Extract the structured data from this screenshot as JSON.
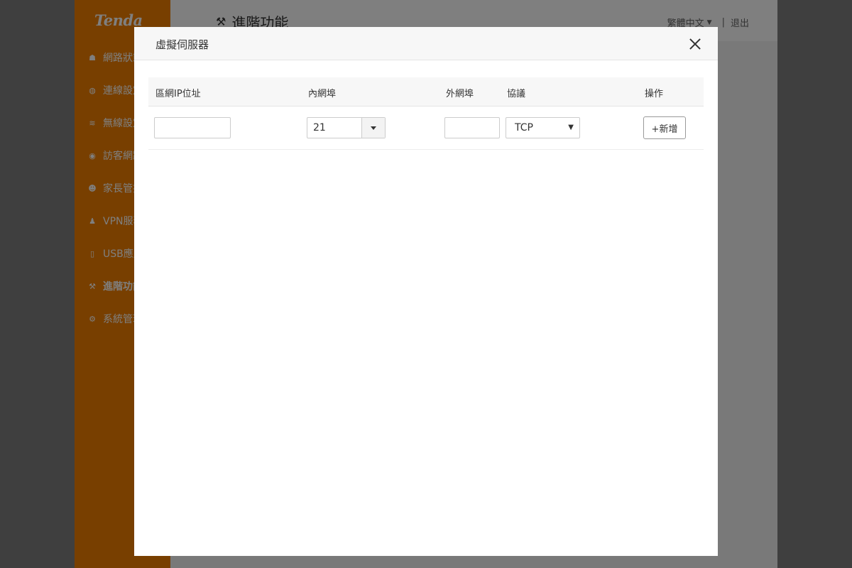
{
  "app": {
    "logo": "Tenda",
    "page_title": "進階功能",
    "language": "繁體中文",
    "separator": "|",
    "logout": "退出"
  },
  "sidebar": {
    "items": [
      {
        "label": "網路狀態",
        "icon": "router-icon"
      },
      {
        "label": "連線設定",
        "icon": "globe-icon"
      },
      {
        "label": "無線設定",
        "icon": "wifi-icon"
      },
      {
        "label": "訪客網路",
        "icon": "guest-icon"
      },
      {
        "label": "家長管控",
        "icon": "parents-icon"
      },
      {
        "label": "VPN服務",
        "icon": "vpn-icon"
      },
      {
        "label": "USB應用",
        "icon": "usb-icon"
      },
      {
        "label": "進階功能",
        "icon": "wrench-icon",
        "active": true
      },
      {
        "label": "系統管理",
        "icon": "gear-icon"
      }
    ]
  },
  "modal": {
    "title": "虛擬伺服器",
    "columns": [
      "區網IP位址",
      "內網埠",
      "外網埠",
      "協議",
      "操作"
    ],
    "row": {
      "lan_ip_value": "",
      "internal_port": "21",
      "external_port_value": "",
      "protocol": "TCP",
      "protocol_options": [
        "TCP"
      ],
      "add_label": "+新增"
    }
  }
}
